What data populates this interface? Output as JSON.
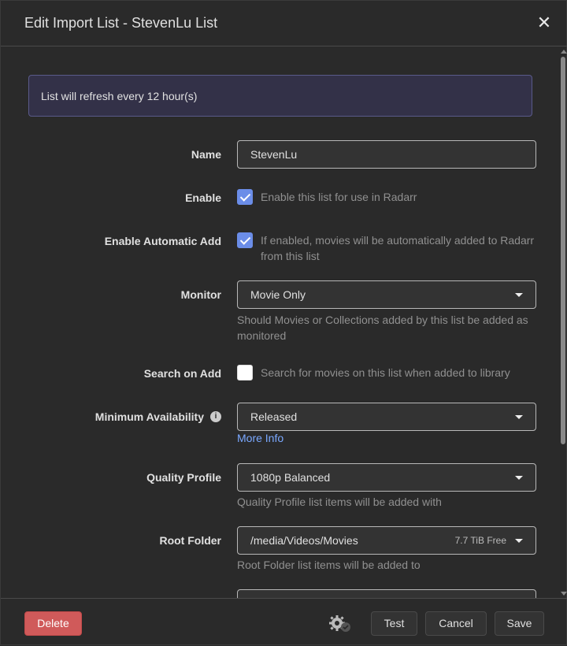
{
  "header": {
    "title": "Edit Import List - StevenLu List",
    "close_icon": "close-icon"
  },
  "info_alert": "List will refresh every 12 hour(s)",
  "fields": {
    "name": {
      "label": "Name",
      "value": "StevenLu"
    },
    "enable": {
      "label": "Enable",
      "checked": true,
      "text": "Enable this list for use in Radarr"
    },
    "auto_add": {
      "label": "Enable Automatic Add",
      "checked": true,
      "text": "If enabled, movies will be automatically added to Radarr from this list"
    },
    "monitor": {
      "label": "Monitor",
      "value": "Movie Only",
      "help": "Should Movies or Collections added by this list be added as monitored"
    },
    "search_on_add": {
      "label": "Search on Add",
      "checked": false,
      "text": "Search for movies on this list when added to library"
    },
    "minimum_availability": {
      "label": "Minimum Availability",
      "value": "Released",
      "link": "More Info"
    },
    "quality_profile": {
      "label": "Quality Profile",
      "value": "1080p Balanced",
      "help": "Quality Profile list items will be added with"
    },
    "root_folder": {
      "label": "Root Folder",
      "value": "/media/Videos/Movies",
      "free": "7.7 TiB Free",
      "help": "Root Folder list items will be added to"
    }
  },
  "footer": {
    "delete": "Delete",
    "test": "Test",
    "cancel": "Cancel",
    "save": "Save"
  },
  "colors": {
    "accent": "#6b8de8",
    "danger": "#d05a5a",
    "link": "#7aa8ff",
    "alert_bg": "#333148"
  }
}
